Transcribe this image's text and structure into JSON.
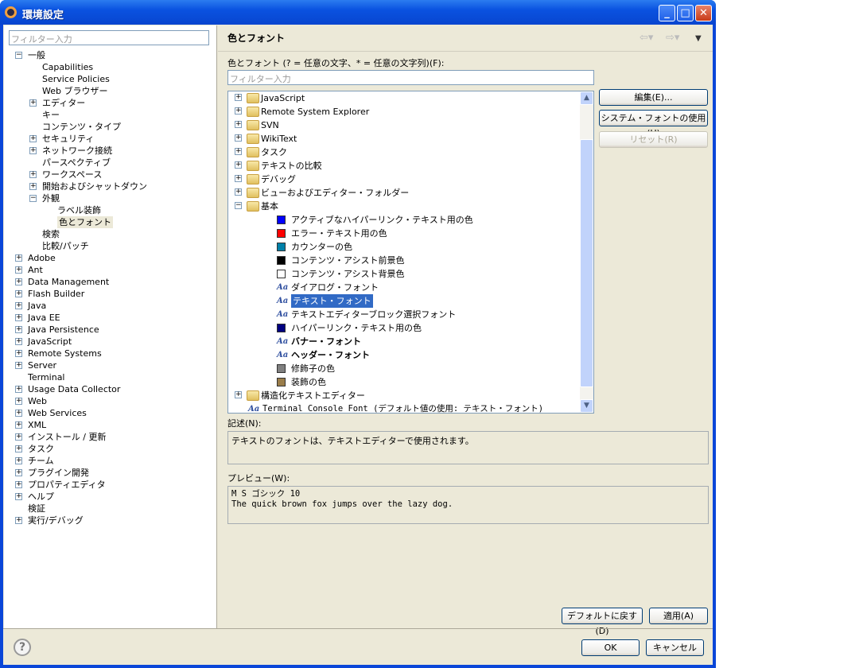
{
  "window": {
    "title": "環境設定"
  },
  "left": {
    "filter_placeholder": "フィルター入力",
    "tree": [
      {
        "label": "一般",
        "level": 0,
        "exp": "-"
      },
      {
        "label": "Capabilities",
        "level": 1
      },
      {
        "label": "Service Policies",
        "level": 1
      },
      {
        "label": "Web ブラウザー",
        "level": 1
      },
      {
        "label": "エディター",
        "level": 1,
        "exp": "+"
      },
      {
        "label": "キー",
        "level": 1
      },
      {
        "label": "コンテンツ・タイプ",
        "level": 1
      },
      {
        "label": "セキュリティ",
        "level": 1,
        "exp": "+"
      },
      {
        "label": "ネットワーク接続",
        "level": 1,
        "exp": "+"
      },
      {
        "label": "パースペクティブ",
        "level": 1
      },
      {
        "label": "ワークスペース",
        "level": 1,
        "exp": "+"
      },
      {
        "label": "開始およびシャットダウン",
        "level": 1,
        "exp": "+"
      },
      {
        "label": "外観",
        "level": 1,
        "exp": "-"
      },
      {
        "label": "ラベル装飾",
        "level": 2
      },
      {
        "label": "色とフォント",
        "level": 2,
        "selected": true
      },
      {
        "label": "検索",
        "level": 1
      },
      {
        "label": "比較/パッチ",
        "level": 1
      },
      {
        "label": "Adobe",
        "level": 0,
        "exp": "+"
      },
      {
        "label": "Ant",
        "level": 0,
        "exp": "+"
      },
      {
        "label": "Data Management",
        "level": 0,
        "exp": "+"
      },
      {
        "label": "Flash Builder",
        "level": 0,
        "exp": "+"
      },
      {
        "label": "Java",
        "level": 0,
        "exp": "+"
      },
      {
        "label": "Java EE",
        "level": 0,
        "exp": "+"
      },
      {
        "label": "Java Persistence",
        "level": 0,
        "exp": "+"
      },
      {
        "label": "JavaScript",
        "level": 0,
        "exp": "+"
      },
      {
        "label": "Remote Systems",
        "level": 0,
        "exp": "+"
      },
      {
        "label": "Server",
        "level": 0,
        "exp": "+"
      },
      {
        "label": "Terminal",
        "level": 0
      },
      {
        "label": "Usage Data Collector",
        "level": 0,
        "exp": "+"
      },
      {
        "label": "Web",
        "level": 0,
        "exp": "+"
      },
      {
        "label": "Web Services",
        "level": 0,
        "exp": "+"
      },
      {
        "label": "XML",
        "level": 0,
        "exp": "+"
      },
      {
        "label": "インストール / 更新",
        "level": 0,
        "exp": "+"
      },
      {
        "label": "タスク",
        "level": 0,
        "exp": "+"
      },
      {
        "label": "チーム",
        "level": 0,
        "exp": "+"
      },
      {
        "label": "プラグイン開発",
        "level": 0,
        "exp": "+"
      },
      {
        "label": "プロパティエディタ",
        "level": 0,
        "exp": "+"
      },
      {
        "label": "ヘルプ",
        "level": 0,
        "exp": "+"
      },
      {
        "label": "検証",
        "level": 0
      },
      {
        "label": "実行/デバッグ",
        "level": 0,
        "exp": "+"
      }
    ]
  },
  "main": {
    "title": "色とフォント",
    "filter_label": "色とフォント (? = 任意の文字、* = 任意の文字列)(F):",
    "filter_placeholder": "フィルター入力",
    "tree": [
      {
        "label": "JavaScript",
        "type": "folder",
        "exp": "+"
      },
      {
        "label": "Remote System Explorer",
        "type": "folder",
        "exp": "+"
      },
      {
        "label": "SVN",
        "type": "folder",
        "exp": "+"
      },
      {
        "label": "WikiText",
        "type": "folder",
        "exp": "+"
      },
      {
        "label": "タスク",
        "type": "folder",
        "exp": "+"
      },
      {
        "label": "テキストの比較",
        "type": "folder",
        "exp": "+"
      },
      {
        "label": "デバッグ",
        "type": "folder",
        "exp": "+"
      },
      {
        "label": "ビューおよびエディター・フォルダー",
        "type": "folder",
        "exp": "+"
      },
      {
        "label": "基本",
        "type": "folder",
        "exp": "-"
      },
      {
        "label": "アクティブなハイパーリンク・テキスト用の色",
        "type": "color",
        "color": "#0000ff"
      },
      {
        "label": "エラー・テキスト用の色",
        "type": "color",
        "color": "#ff0000"
      },
      {
        "label": "カウンターの色",
        "type": "color",
        "color": "#0080a8"
      },
      {
        "label": "コンテンツ・アシスト前景色",
        "type": "color",
        "color": "#000000"
      },
      {
        "label": "コンテンツ・アシスト背景色",
        "type": "color",
        "color": "#ffffff"
      },
      {
        "label": "ダイアログ・フォント",
        "type": "font"
      },
      {
        "label": "テキスト・フォント",
        "type": "font",
        "selected": true
      },
      {
        "label": "テキストエディターブロック選択フォント",
        "type": "font"
      },
      {
        "label": "ハイパーリンク・テキスト用の色",
        "type": "color",
        "color": "#000080"
      },
      {
        "label": "バナー・フォント",
        "type": "font",
        "bold": true
      },
      {
        "label": "ヘッダー・フォント",
        "type": "font",
        "bold": true
      },
      {
        "label": "修飾子の色",
        "type": "color",
        "color": "#808080"
      },
      {
        "label": "装飾の色",
        "type": "color",
        "color": "#9a7d4a"
      },
      {
        "label": "構造化テキストエディター",
        "type": "folder",
        "exp": "+",
        "top": true
      },
      {
        "label": "Terminal Console Font (デフォルト値の使用: テキスト・フォント)",
        "type": "font",
        "top": true,
        "mono": true
      }
    ],
    "buttons": {
      "edit": "編集(E)...",
      "system_font": "システム・フォントの使用(U)",
      "reset": "リセット(R)"
    },
    "description_label": "記述(N):",
    "description": "テキストのフォントは、テキストエディターで使用されます。",
    "preview_label": "プレビュー(W):",
    "preview_font": "M S ゴシック 10",
    "preview_text": "The quick brown fox jumps over the lazy dog.",
    "restore_defaults": "デフォルトに戻す(D)",
    "apply": "適用(A)"
  },
  "footer": {
    "ok": "OK",
    "cancel": "キャンセル"
  }
}
